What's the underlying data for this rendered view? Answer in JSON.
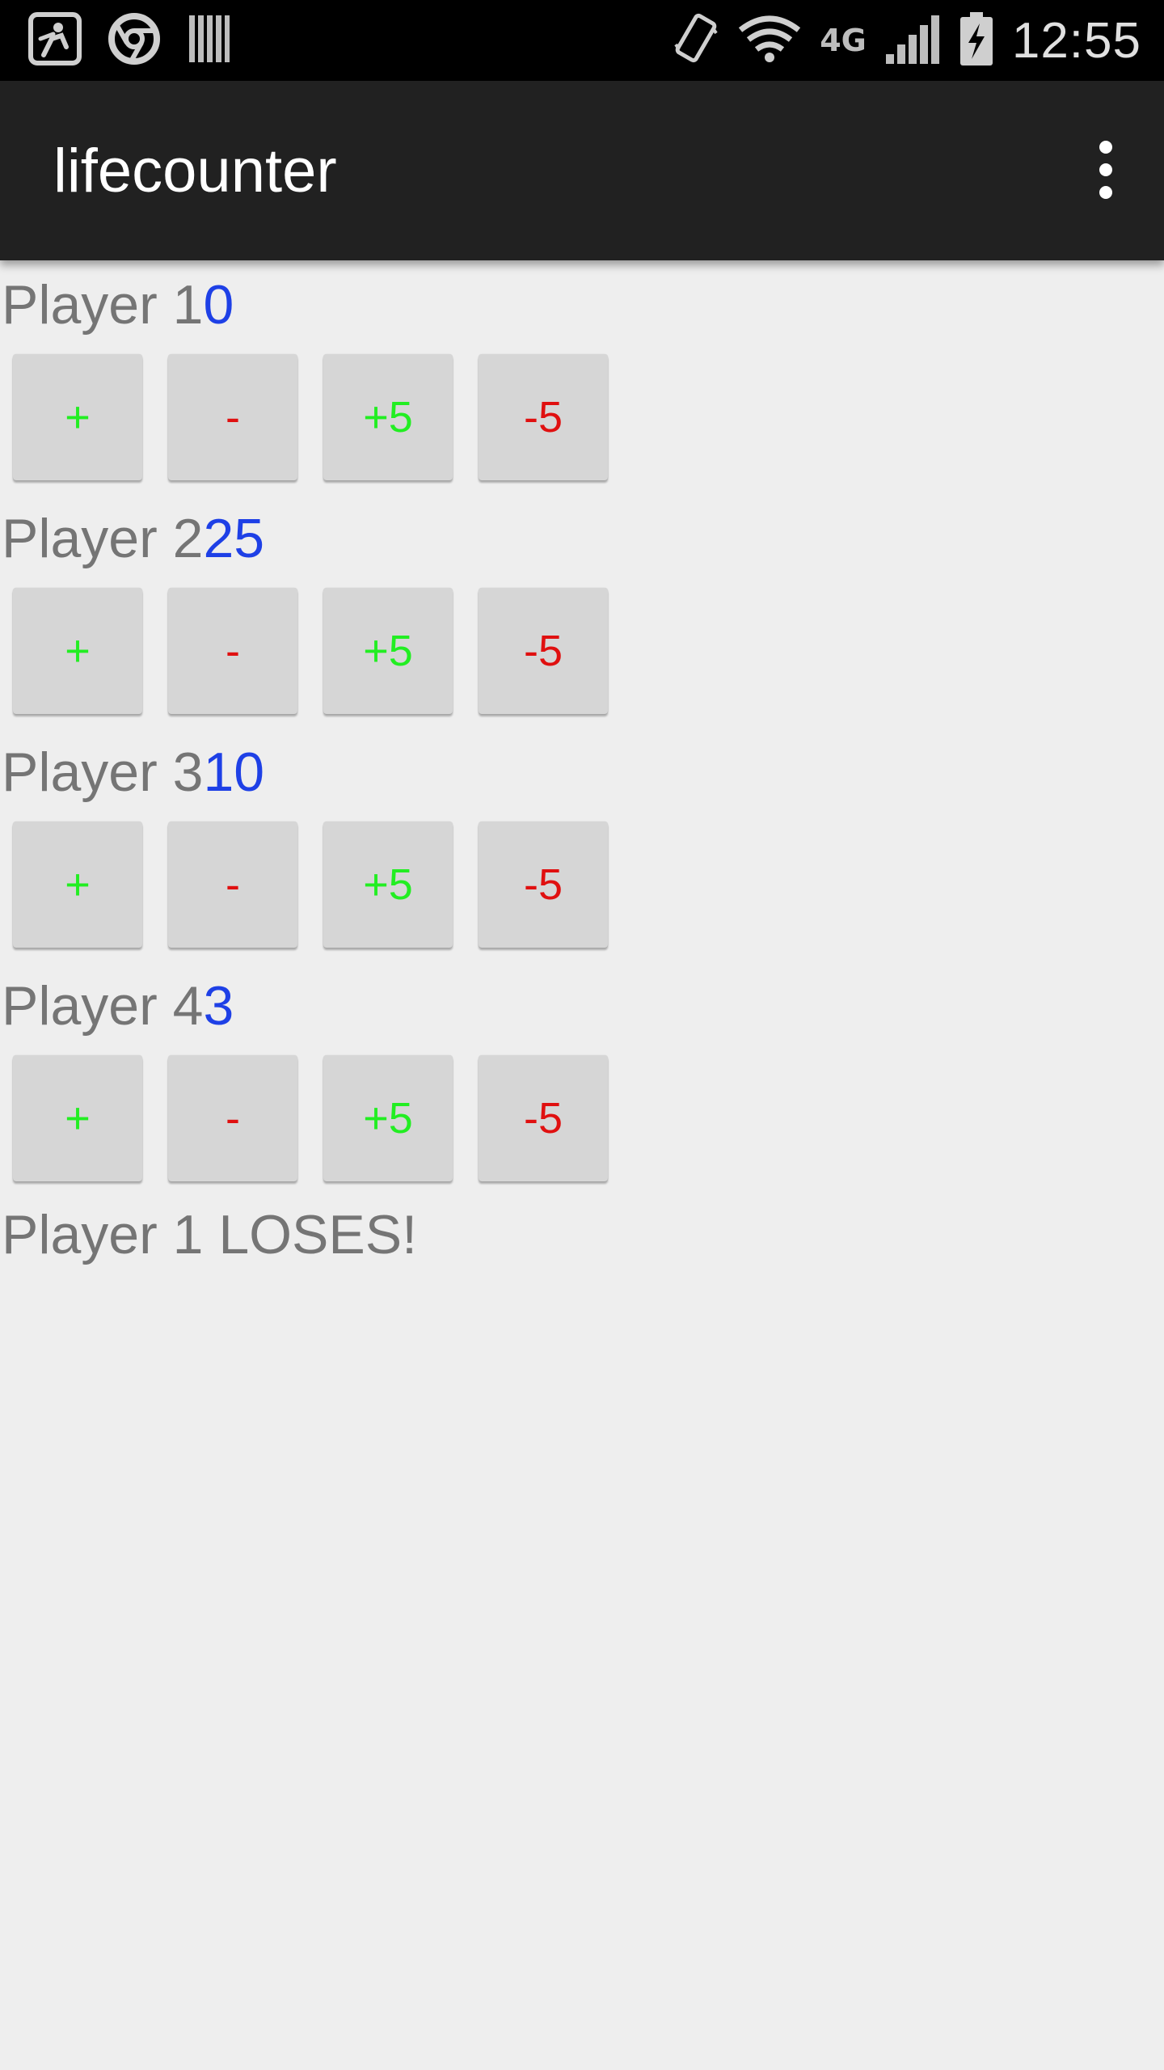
{
  "status_bar": {
    "time": "12:55",
    "network_label": "4G",
    "left_icons": [
      "golf-app-icon",
      "chrome-icon",
      "barcode-icon"
    ],
    "right_icons": [
      "vibrate-icon",
      "wifi-icon",
      "network-4g-icon",
      "signal-icon",
      "battery-charging-icon"
    ]
  },
  "app_bar": {
    "title": "lifecounter",
    "menu_icon": "overflow-menu-icon"
  },
  "players": [
    {
      "label": "Player 1",
      "life": "0"
    },
    {
      "label": "Player 2",
      "life": "25"
    },
    {
      "label": "Player 3",
      "life": "10"
    },
    {
      "label": "Player 4",
      "life": "3"
    }
  ],
  "buttons": {
    "plus": "+",
    "minus": "-",
    "plus_five": "+5",
    "minus_five": "-5"
  },
  "result_message": "Player 1 LOSES!",
  "colors": {
    "life_value": "#1e40e6",
    "positive": "#22ee22",
    "negative": "#e01010",
    "app_bar": "#212121",
    "background": "#eeeeee"
  }
}
